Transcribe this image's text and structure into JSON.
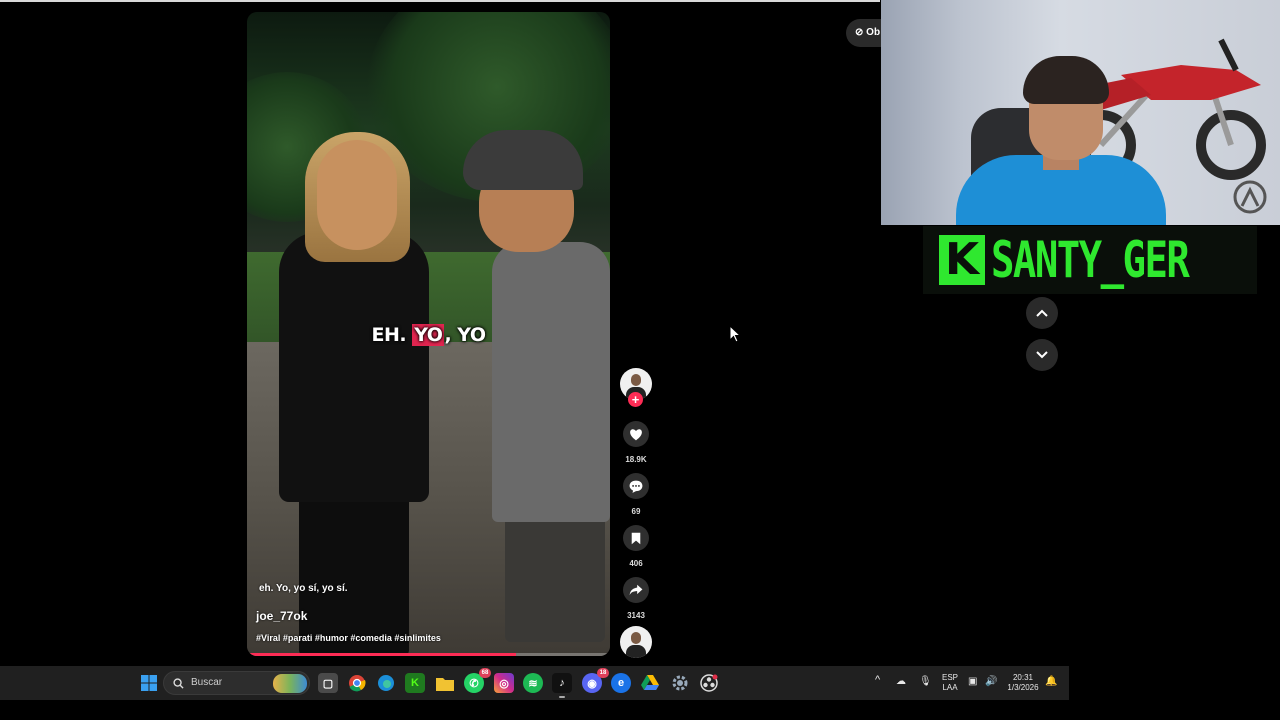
{
  "video": {
    "center_caption_pre": "EH. ",
    "center_caption_highlight": "YO",
    "center_caption_post": ", YO",
    "subtitle": "eh. Yo, yo sí, yo sí.",
    "username": "joe_77ok",
    "hashtags": "#Viral #parati #humor #comedia #sinlimites",
    "progress": 0.74
  },
  "actions": {
    "likes": "18.9K",
    "comments": "69",
    "saves": "406",
    "shares": "3143"
  },
  "top_pill": {
    "label": "Ob"
  },
  "overlay": {
    "streamer_name": "SANTY_GER",
    "logo_letter": "K"
  },
  "taskbar": {
    "search_placeholder": "Buscar",
    "whatsapp_badge": "68",
    "discord_badge": "18",
    "language": "ESP",
    "layout": "LAA",
    "time": "20:31",
    "date": "1/3/2026"
  },
  "colors": {
    "tiktok_red": "#fe2c55",
    "overlay_green": "#2fe82f",
    "taskbar_bg": "#202020"
  }
}
